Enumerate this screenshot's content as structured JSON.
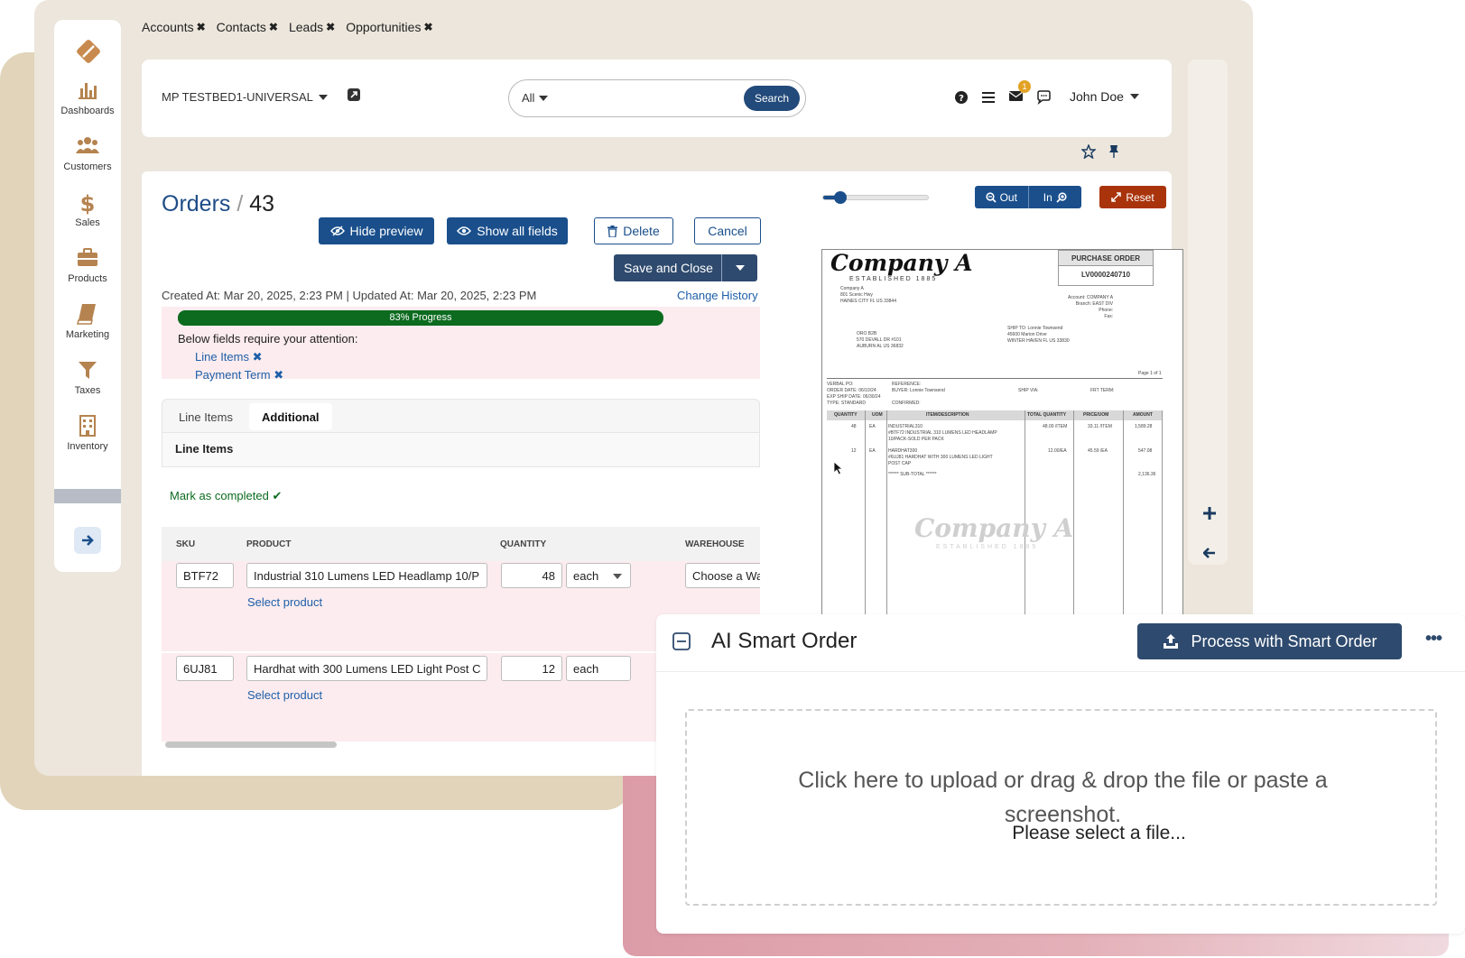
{
  "top_tabs": [
    {
      "label": "Accounts"
    },
    {
      "label": "Contacts"
    },
    {
      "label": "Leads"
    },
    {
      "label": "Opportunities"
    }
  ],
  "sidebar": {
    "items": [
      {
        "label": "Dashboards",
        "icon": "bar-chart-icon"
      },
      {
        "label": "Customers",
        "icon": "users-icon"
      },
      {
        "label": "Sales",
        "icon": "dollar-icon"
      },
      {
        "label": "Products",
        "icon": "briefcase-icon"
      },
      {
        "label": "Marketing",
        "icon": "book-icon"
      },
      {
        "label": "Taxes",
        "icon": "funnel-icon"
      },
      {
        "label": "Inventory",
        "icon": "building-icon"
      }
    ]
  },
  "header": {
    "tenant": "MP TESTBED1-UNIVERSAL",
    "search_scope": "All",
    "search_button": "Search",
    "mail_badge": "1",
    "user_name": "John Doe"
  },
  "record": {
    "breadcrumb_parent": "Orders",
    "breadcrumb_sep": "/",
    "record_id": "43",
    "hide_preview": "Hide preview",
    "show_all_fields": "Show all fields",
    "delete": "Delete",
    "cancel": "Cancel",
    "save_close": "Save and Close",
    "created_at": "Created At: Mar 20, 2025, 2:23 PM",
    "meta_sep": "|",
    "updated_at": "Updated At: Mar 20, 2025, 2:23 PM",
    "change_history": "Change History"
  },
  "attention": {
    "progress_label": "83% Progress",
    "progress": 0.83,
    "title": "Below fields require your attention:",
    "fields": [
      "Line Items",
      "Payment Term"
    ]
  },
  "tabs": [
    {
      "label": "Line Items",
      "active": false
    },
    {
      "label": "Additional",
      "active": true
    }
  ],
  "section_title": "Line Items",
  "mark_completed": "Mark as completed",
  "grid": {
    "columns": [
      "SKU",
      "PRODUCT",
      "QUANTITY",
      "WAREHOUSE"
    ],
    "rows": [
      {
        "sku": "BTF72",
        "product": "Industrial 310 Lumens LED Headlamp 10/P",
        "qty": "48",
        "uom": "each",
        "warehouse": "Choose a Wa",
        "select_product": "Select product"
      },
      {
        "sku": "6UJ81",
        "product": "Hardhat with 300 Lumens LED Light Post C",
        "qty": "12",
        "uom": "each",
        "warehouse": "",
        "select_product": "Select product"
      }
    ]
  },
  "preview": {
    "zoom_level": 0.15,
    "zoom_out": "Out",
    "zoom_in": "In",
    "reset": "Reset",
    "doc": {
      "company": "Company A",
      "established": "ESTABLISHED 1885",
      "company_addr": "Company A\n801 Scenic Hwy\nHAINES CITY FL US 33844",
      "po_title": "PURCHASE ORDER",
      "po_number": "LV0000240710",
      "account_block": "Account: COMPANY A\nBranch: EAST DIV\nPhone:\nFax:",
      "ship_to": "SHIP TO: Lonnie Townsend\n45600 Marion Drive\nWINTER HAVEN FL US 33830",
      "bill_to": "ORO B2B\n570 DEVALL DR #101\nAUBURN AL US 36832",
      "page": "Page 1 of 1",
      "order_info": "VERBAL PO:\nORDER DATE: 06/10/24\nEXP SHIP DATE: 06/30/24\nTYPE: STANDARD",
      "buyer_info": "REFERENCE:\nBUYER: Lonnie Townsend\n\nCONFIRMED:",
      "ship_via": "SHIP VIA:",
      "frt_term": "FRT TERM:",
      "headers": [
        "QUANTITY",
        "UOM",
        "ITEM/DESCRIPTION",
        "TOTAL QUANTITY",
        "PRICE/UOM",
        "AMOUNT"
      ],
      "lines": [
        {
          "qty": "48",
          "uom": "EA",
          "desc": "INDUSTRIAL310\n#BTF72 INDUSTRIAL 310 LUMENS LED HEADLAMP\n10/PACK-SOLD PER PACK",
          "total": "48.00 /ITEM",
          "price": "33.11 /ITEM",
          "amount": "1,589.28"
        },
        {
          "qty": "12",
          "uom": "EA",
          "desc": "HARDHAT300\n#6UJ81 HARDHAT WITH 300 LUMENS LED LIGHT\nPOST CAP",
          "total": "12.00/EA",
          "price": "45.59 /EA",
          "amount": "547.08"
        }
      ],
      "subtotal_label": "****** SUB-TOTAL ******",
      "subtotal": "2,136.36"
    }
  },
  "ai_card": {
    "title": "AI Smart Order",
    "process_button": "Process with Smart Order",
    "more": "•••",
    "drop_text": "Click here to upload or drag & drop the file or paste a screenshot.",
    "drop_sub": "Please select a file..."
  },
  "colors": {
    "brand": "#1a4f8c",
    "dark_button": "#2e4a6e",
    "progress": "#0c6b1f",
    "attention_bg": "#fcecef",
    "reset": "#a9340c",
    "sidebar_icon": "#b5834f"
  }
}
